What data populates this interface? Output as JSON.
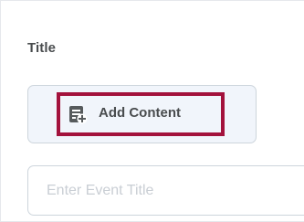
{
  "form": {
    "title_label": "Title",
    "add_content_label": "Add Content",
    "add_content_icon": "add-content-icon",
    "title_input": {
      "value": "",
      "placeholder": "Enter Event Title"
    },
    "highlight_color": "#a3123c"
  }
}
